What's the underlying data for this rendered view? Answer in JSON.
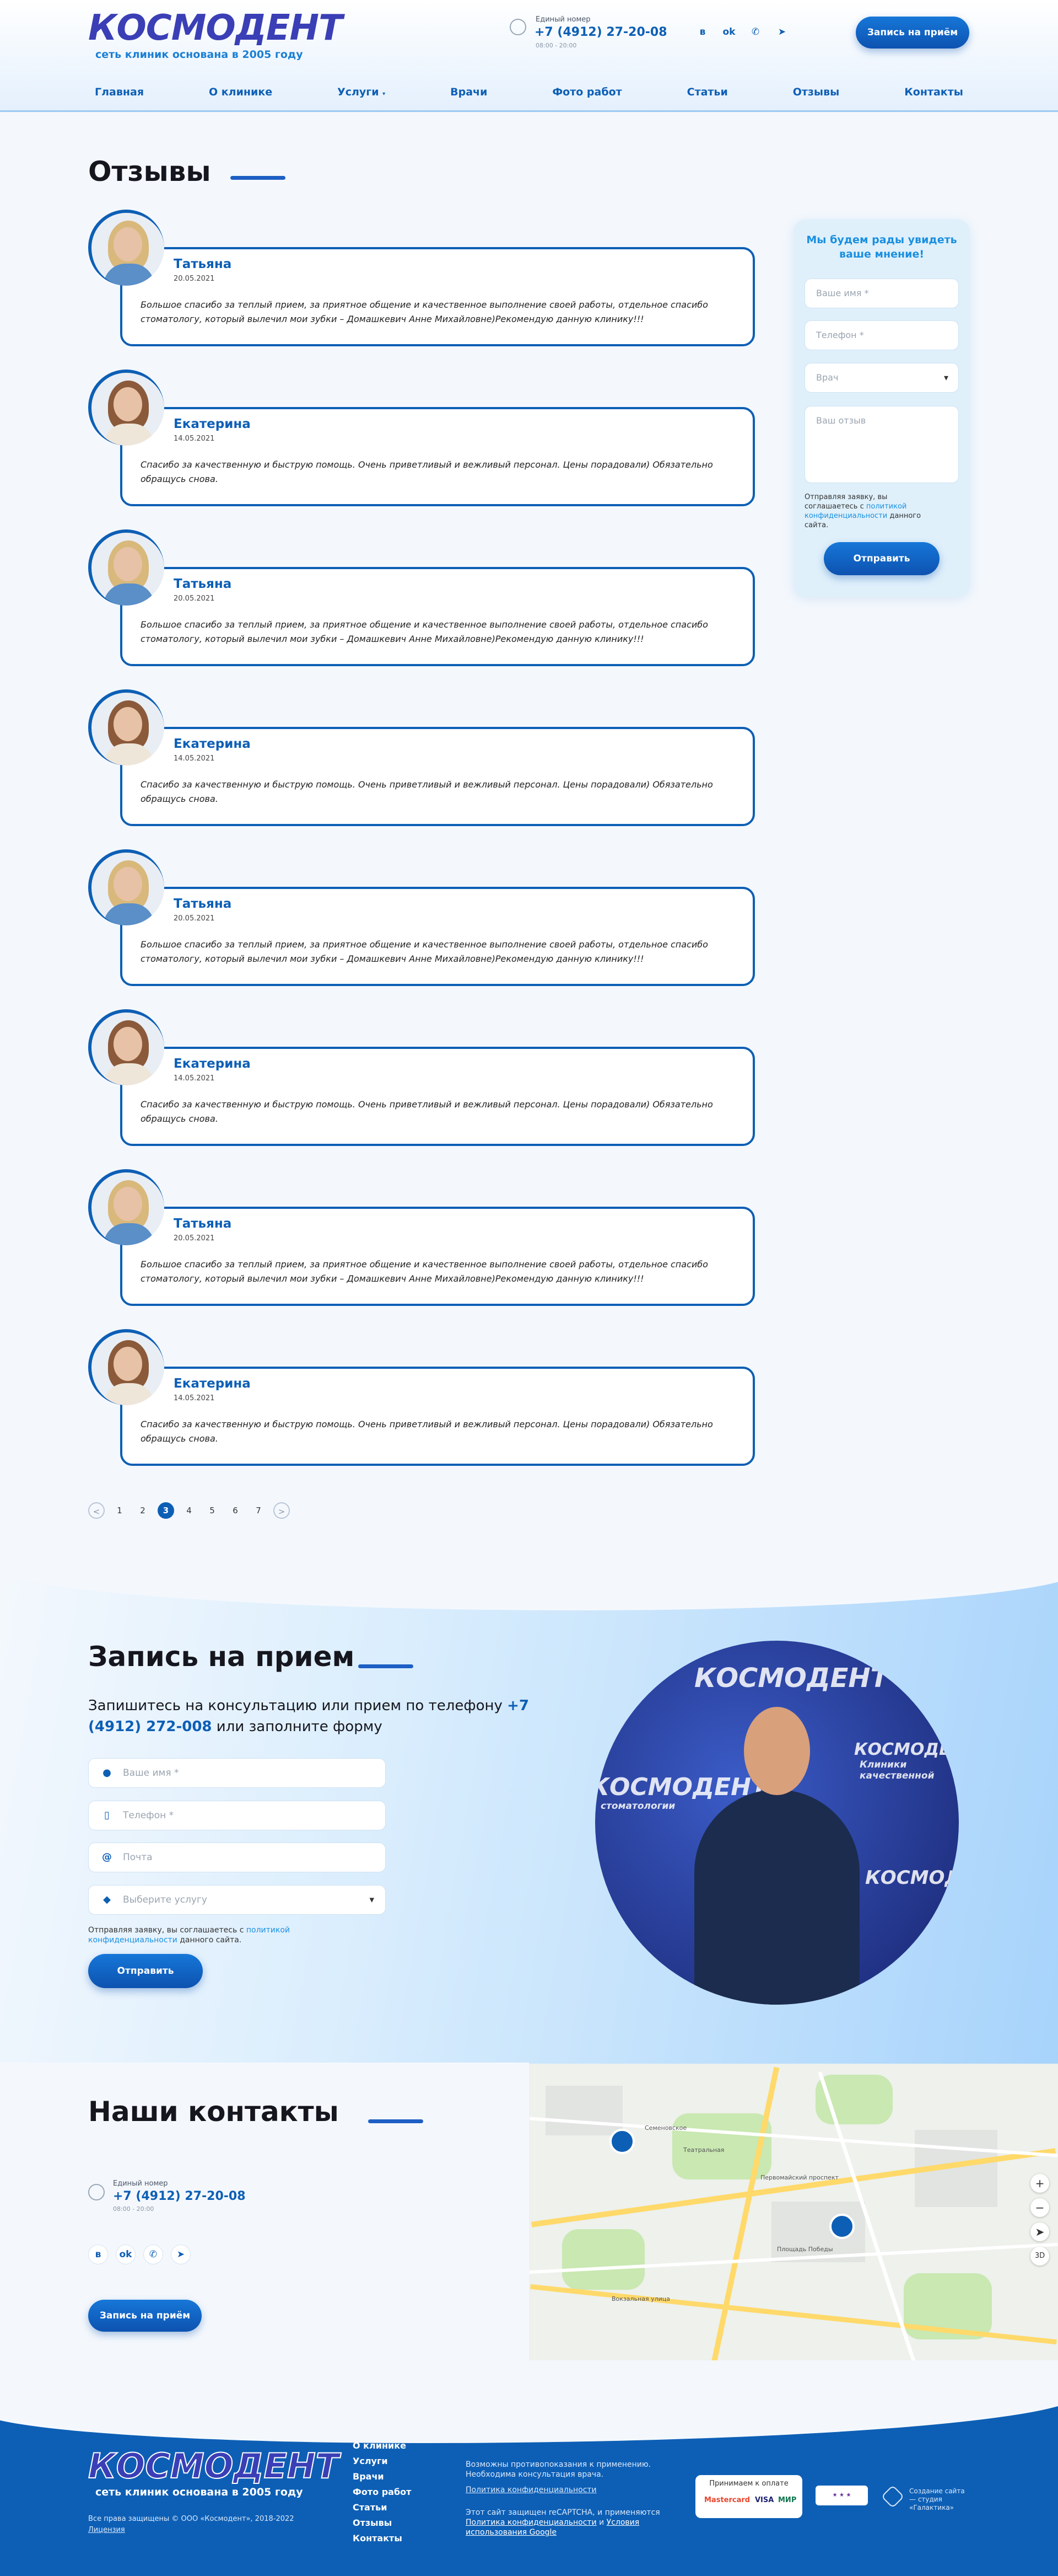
{
  "header": {
    "logo_text": "КОСМОДЕНТ",
    "logo_subtitle": "сеть клиник основана в 2005 году",
    "phone_label": "Единый номер",
    "phone_number": "+7 (4912) 27-20-08",
    "phone_hours": "08:00 - 20:00",
    "socials": [
      "vk-icon",
      "odnoklassniki-icon",
      "whatsapp-icon",
      "telegram-icon"
    ],
    "cta_label": "Запись на приём",
    "nav": [
      "Главная",
      "О клинике",
      "Услуги",
      "Врачи",
      "Фото работ",
      "Статьи",
      "Отзывы",
      "Контакты"
    ]
  },
  "page": {
    "title": "Отзывы"
  },
  "reviews": [
    {
      "name": "Татьяна",
      "date": "20.05.2021",
      "text": "Большое спасибо за теплый прием, за приятное общение и качественное выполнение своей работы, отдельное спасибо стоматологу, который вылечил мои зубки – Домашкевич Анне Михайловне)Рекомендую данную клинику!!!"
    },
    {
      "name": "Екатерина",
      "date": "14.05.2021",
      "text": "Спасибо за качественную и быструю помощь. Очень приветливый и вежливый персонал. Цены порадовали) Обязательно обращусь снова."
    },
    {
      "name": "Татьяна",
      "date": "20.05.2021",
      "text": "Большое спасибо за теплый прием, за приятное общение и качественное выполнение своей работы, отдельное спасибо стоматологу, который вылечил мои зубки – Домашкевич Анне Михайловне)Рекомендую данную клинику!!!"
    },
    {
      "name": "Екатерина",
      "date": "14.05.2021",
      "text": "Спасибо за качественную и быструю помощь. Очень приветливый и вежливый персонал. Цены порадовали) Обязательно обращусь снова."
    },
    {
      "name": "Татьяна",
      "date": "20.05.2021",
      "text": "Большое спасибо за теплый прием, за приятное общение и качественное выполнение своей работы, отдельное спасибо стоматологу, который вылечил мои зубки – Домашкевич Анне Михайловне)Рекомендую данную клинику!!!"
    },
    {
      "name": "Екатерина",
      "date": "14.05.2021",
      "text": "Спасибо за качественную и быструю помощь. Очень приветливый и вежливый персонал. Цены порадовали) Обязательно обращусь снова."
    },
    {
      "name": "Татьяна",
      "date": "20.05.2021",
      "text": "Большое спасибо за теплый прием, за приятное общение и качественное выполнение своей работы, отдельное спасибо стоматологу, который вылечил мои зубки – Домашкевич Анне Михайловне)Рекомендую данную клинику!!!"
    },
    {
      "name": "Екатерина",
      "date": "14.05.2021",
      "text": "Спасибо за качественную и быструю помощь. Очень приветливый и вежливый персонал. Цены порадовали) Обязательно обращусь снова."
    }
  ],
  "sidebar_form": {
    "title": "Мы будем рады увидеть ваше мнение!",
    "name_placeholder": "Ваше имя *",
    "phone_placeholder": "Телефон *",
    "doctor_select": "Врач",
    "review_placeholder": "Ваш отзыв",
    "consent_prefix": "Отправляя заявку, вы соглашаетесь с",
    "consent_link": "политикой конфиденциальности",
    "consent_suffix": "данного сайта.",
    "submit_label": "Отправить"
  },
  "pagination": {
    "prev": "<",
    "pages": [
      "1",
      "2",
      "3",
      "4",
      "5",
      "6",
      "7"
    ],
    "current": "3",
    "next": ">"
  },
  "booking": {
    "title": "Запись на прием",
    "subtitle_prefix": "Запишитесь на консультацию или прием по телефону",
    "subtitle_phone": "+7 (4912) 272-008",
    "subtitle_suffix": "или заполните форму",
    "name_placeholder": "Ваше имя *",
    "phone_placeholder": "Телефон *",
    "email_placeholder": "Почта",
    "service_select": "Выберите услугу",
    "consent_prefix": "Отправляя заявку, вы соглашаетесь с",
    "consent_link": "политикой конфиденциальности",
    "consent_suffix": "данного сайта.",
    "submit_label": "Отправить",
    "photo_brand_text": [
      "КОСМОДЕНТ",
      "Клиники качественной",
      "стоматологии"
    ]
  },
  "contacts": {
    "title": "Наши контакты",
    "phone_label": "Единый номер",
    "phone_number": "+7 (4912) 27-20-08",
    "phone_hours": "08:00 - 20:00",
    "socials": [
      "vk-icon",
      "odnoklassniki-icon",
      "whatsapp-icon",
      "telegram-icon"
    ],
    "cta_label": "Запись на приём",
    "map_labels": [
      "Семеновское",
      "Первомайский проспект",
      "Театральная",
      "Площадь Победы",
      "Вокзальная улица"
    ]
  },
  "footer": {
    "logo_text": "КОСМОДЕНТ",
    "logo_subtitle": "сеть клиник основана в 2005 году",
    "copyright": "Все права защищены © ООО «Космодент», 2018-2022",
    "license": "Лицензия",
    "nav": [
      "О клинике",
      "Услуги",
      "Врачи",
      "Фото работ",
      "Статьи",
      "Отзывы",
      "Контакты"
    ],
    "warning": "Возможны противопоказания к применению. Необходима консультация врача.",
    "policy": "Политика конфиденциальности",
    "recaptcha_prefix": "Этот сайт защищен reCAPTCHA, и применяются",
    "recaptcha_policy": "Политика конфиденциальности",
    "recaptcha_and": "и",
    "recaptcha_terms": "Условия использования Google",
    "payment_label": "Принимаем к оплате",
    "payment_systems": [
      "Mastercard",
      "VISA",
      "МИР"
    ],
    "developer": "Создание сайта — студия «Галактика»"
  },
  "colors": {
    "brand_blue": "#0d5fb5",
    "logo_violet": "#3a3fb6",
    "accent_light_blue": "#1a8fe0"
  }
}
